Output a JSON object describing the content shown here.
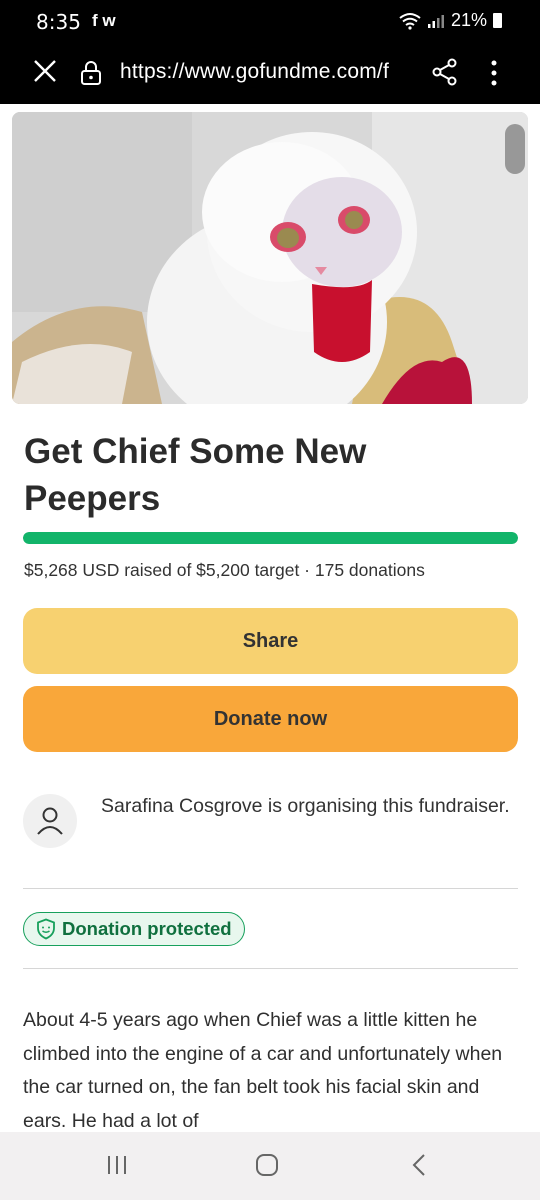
{
  "status_bar": {
    "time": "8:35",
    "app_icons": "f w",
    "battery": "21%"
  },
  "browser": {
    "url": "https://www.gofundme.com/f",
    "icons": [
      "close-icon",
      "lock-icon",
      "share-icon",
      "more-vertical-icon"
    ]
  },
  "campaign": {
    "title": "Get Chief Some New Peepers",
    "progress_fraction": 1.0,
    "progress_color": "#12b46a",
    "raised_text": "$5,268 USD raised of $5,200 target · 175 donations",
    "share_label": "Share",
    "donate_label": "Donate now",
    "organiser_text": "Sarafina Cosgrove is organising this fundraiser.",
    "badge_label": "Donation protected",
    "story": "About 4-5 years ago when Chief was a little kitten he climbed into the engine of a car and unfortunately when the car turned on, the fan belt took his facial skin and ears. He had a lot of"
  },
  "colors": {
    "share_button": "#f7d170",
    "donate_button": "#f9a73a",
    "badge_green": "#17a05c"
  }
}
